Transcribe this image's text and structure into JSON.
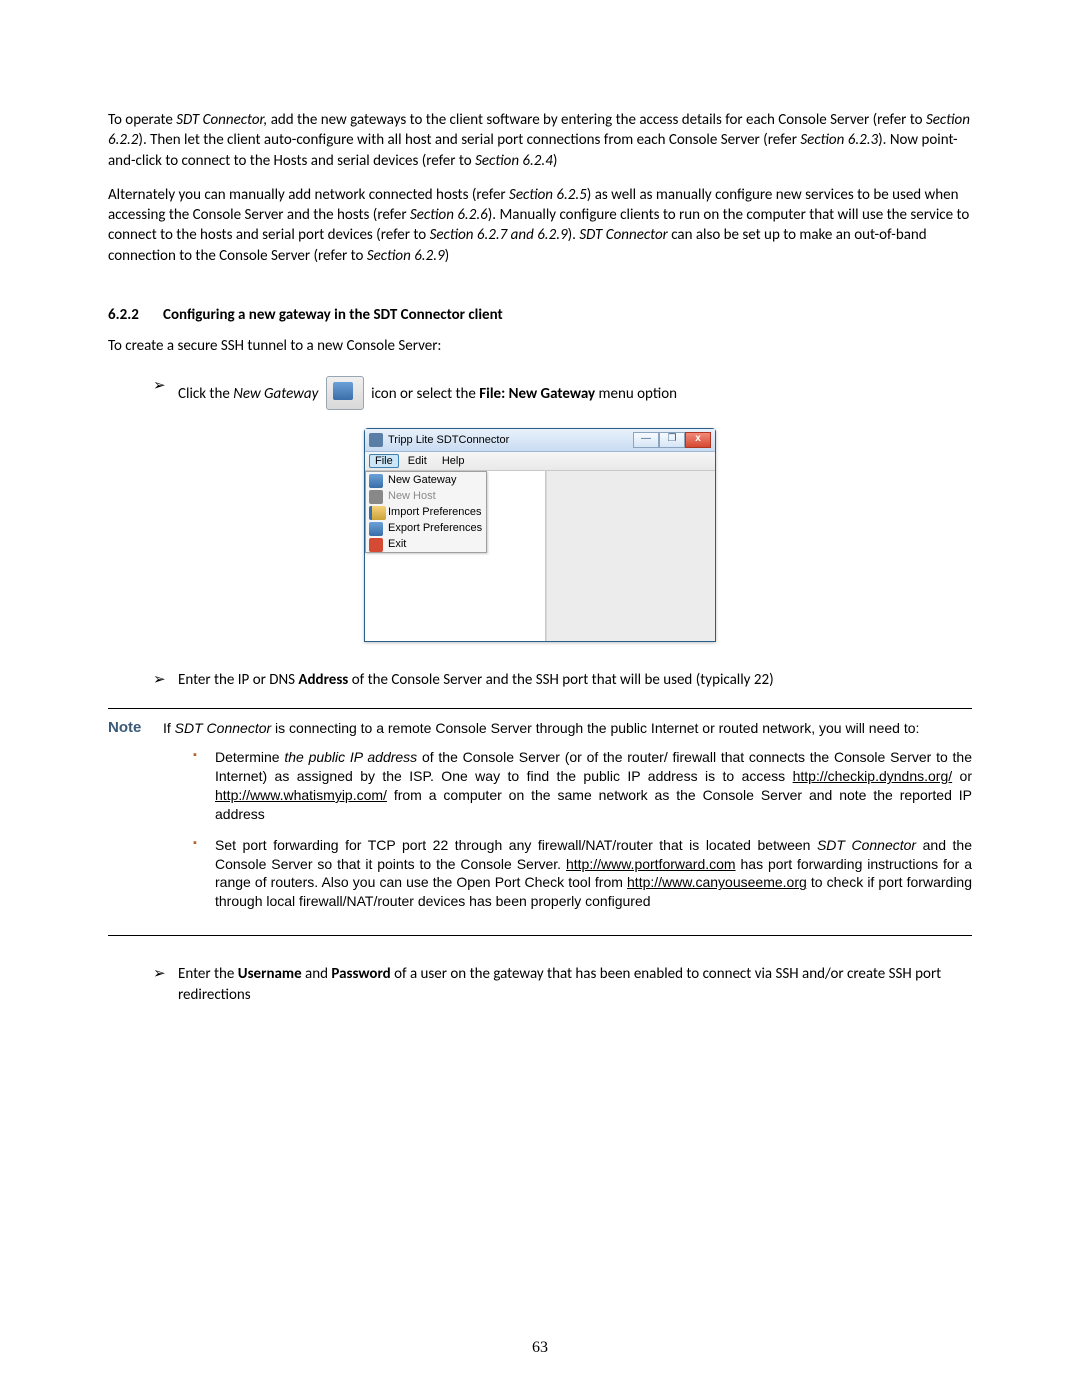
{
  "para1": {
    "lead": "To operate ",
    "em1": "SDT Connector,",
    "t1": " add the new gateways to the client software by entering the access details for each Console Server (refer to ",
    "em2": "Section 6.2.2",
    "t2": "). Then let the client auto-configure with all host and serial port connections from each Console Server (refer ",
    "em3": "Section 6.2.3",
    "t3": "). Now point-and-click to connect to the Hosts and serial devices (refer to ",
    "em4": "Section 6.2.4",
    "t4": ")"
  },
  "para2": {
    "t1": "Alternately you can manually add network connected hosts (refer ",
    "em1": "Section 6.2.5",
    "t2": ") as well as manually configure new services to be used when accessing the Console Server and the hosts (refer ",
    "em2": "Section 6.2.6",
    "t3": "). Manually configure clients to run on the computer that will use the service to connect to the hosts and serial port devices (refer to ",
    "em3": "Section 6.2.7 and 6.2.9",
    "t4": "). ",
    "em4": "SDT Connector",
    "t5": " can also be set up to make an out-of-band connection to the Console Server (refer to ",
    "em5": "Section 6.2.9",
    "t6": ")"
  },
  "heading": {
    "num": "6.2.2",
    "title": "Configuring a new gateway in the SDT Connector client"
  },
  "intro": "To create a secure SSH tunnel to a new Console Server:",
  "bullet1": {
    "t1": "Click the ",
    "em1": "New Gateway",
    "t2": " icon or select the ",
    "b1": "File: New Gateway",
    "t3": " menu option"
  },
  "window": {
    "title": "Tripp Lite SDTConnector",
    "menus": {
      "file": "File",
      "edit": "Edit",
      "help": "Help"
    },
    "items": {
      "new_gateway": "New Gateway",
      "new_host": "New Host",
      "import_prefs": "Import Preferences",
      "export_prefs": "Export Preferences",
      "exit": "Exit"
    },
    "btns": {
      "min": "—",
      "max": "❐",
      "close": "x"
    }
  },
  "bullet2": {
    "t1": "Enter the IP or DNS ",
    "b1": "Address",
    "t2": " of the Console Server and the SSH port that will be used (typically 22)"
  },
  "note": {
    "label": "Note",
    "intro1": "If ",
    "em1": "SDT Connector",
    "intro2": " is connecting to a remote Console Server through the public Internet or routed network, you will need to:",
    "li1": {
      "t1": "Determine ",
      "em1": "the public IP address",
      "t2": " of the Console Server (or of the router/ firewall that connects the Console Server to the Internet) as assigned by the ISP. One way to find the public IP address is to access ",
      "link1": "http://checkip.dyndns.org/",
      "t3": " or ",
      "link2": "http://www.whatismyip.com/",
      "t4": " from a computer on the same network as the Console Server and note the reported IP address"
    },
    "li2": {
      "t1": "Set port forwarding for TCP port 22 through any firewall/NAT/router that is located between ",
      "em1": "SDT Connector",
      "t2": " and the Console Server so that it points to the Console Server. ",
      "link1": "http://www.portforward.com",
      "t3": " has port forwarding instructions for a range of routers. Also you can use the Open Port Check tool from ",
      "link2": "http://www.canyouseeme.org",
      "t4": " to check if port forwarding through local firewall/NAT/router devices has been properly configured"
    }
  },
  "bullet3": {
    "t1": "Enter the ",
    "b1": "Username",
    "t2": " and ",
    "b2": "Password",
    "t3": " of a user on the gateway that has been enabled to connect via SSH and/or create SSH port redirections"
  },
  "page_number": "63"
}
